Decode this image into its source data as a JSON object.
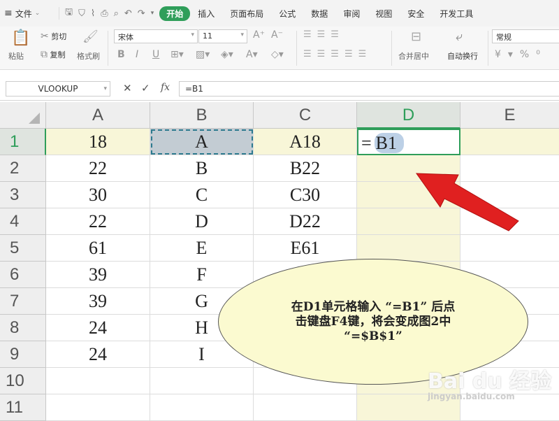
{
  "menu": {
    "file_label": "文件",
    "tabs": [
      "开始",
      "插入",
      "页面布局",
      "公式",
      "数据",
      "审阅",
      "视图",
      "安全",
      "开发工具"
    ],
    "active_tab": "开始"
  },
  "ribbon": {
    "paste": "粘贴",
    "cut": "剪切",
    "copy": "复制",
    "format_painter": "格式刷",
    "font_name": "宋体",
    "font_size": "11",
    "merge_center": "合并居中",
    "wrap_text": "自动换行",
    "number_format": "常规"
  },
  "formula_bar": {
    "name_box": "VLOOKUP",
    "formula": "=B1",
    "fx": "fx"
  },
  "sheet": {
    "columns": [
      "A",
      "B",
      "C",
      "D",
      "E"
    ],
    "rows": [
      "1",
      "2",
      "3",
      "4",
      "5",
      "6",
      "7",
      "8",
      "9",
      "10",
      "11"
    ],
    "colA": [
      "18",
      "22",
      "30",
      "22",
      "61",
      "39",
      "39",
      "24",
      "24",
      "",
      ""
    ],
    "colB": [
      "A",
      "B",
      "C",
      "D",
      "E",
      "F",
      "G",
      "H",
      "I",
      "",
      ""
    ],
    "colC": [
      "A18",
      "B22",
      "C30",
      "D22",
      "E61",
      "",
      "",
      "",
      "",
      "",
      ""
    ],
    "d1_eq": "=",
    "d1_ref": "B1"
  },
  "callout": {
    "line1": "在D1单元格输入 “=B1” 后点",
    "line2": "击键盘F4键，将会变成图2中",
    "line3": "“=$B$1”"
  },
  "watermark": {
    "brand": "Bai du 经验",
    "url": "jingyan.baidu.com"
  },
  "colors": {
    "accent": "#2f9e5a",
    "highlight": "#f8f6d8",
    "arrow": "#e02020"
  }
}
